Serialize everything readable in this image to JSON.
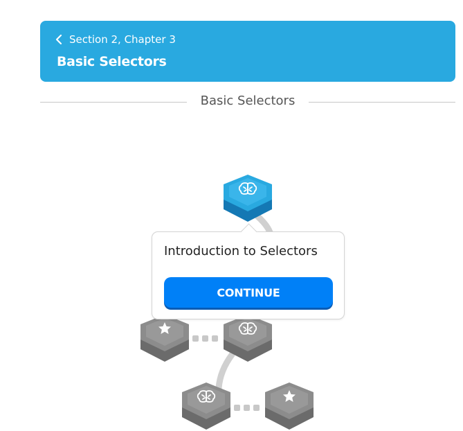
{
  "header": {
    "back_label": "Section 2, Chapter 3",
    "title": "Basic Selectors",
    "background_color": "#29a9e0"
  },
  "section": {
    "title": "Basic Selectors"
  },
  "popup": {
    "lesson_title": "Introduction to Selectors",
    "continue_label": "CONTINUE",
    "button_color": "#0080f7"
  },
  "nodes": [
    {
      "icon": "brain-icon",
      "state": "active",
      "color": "#29a9e0"
    },
    {
      "icon": "star-icon",
      "state": "locked",
      "color": "#8c8c8c"
    },
    {
      "icon": "brain-icon",
      "state": "locked",
      "color": "#8c8c8c"
    },
    {
      "icon": "brain-icon",
      "state": "locked",
      "color": "#8c8c8c"
    },
    {
      "icon": "star-icon",
      "state": "locked",
      "color": "#8c8c8c"
    }
  ]
}
